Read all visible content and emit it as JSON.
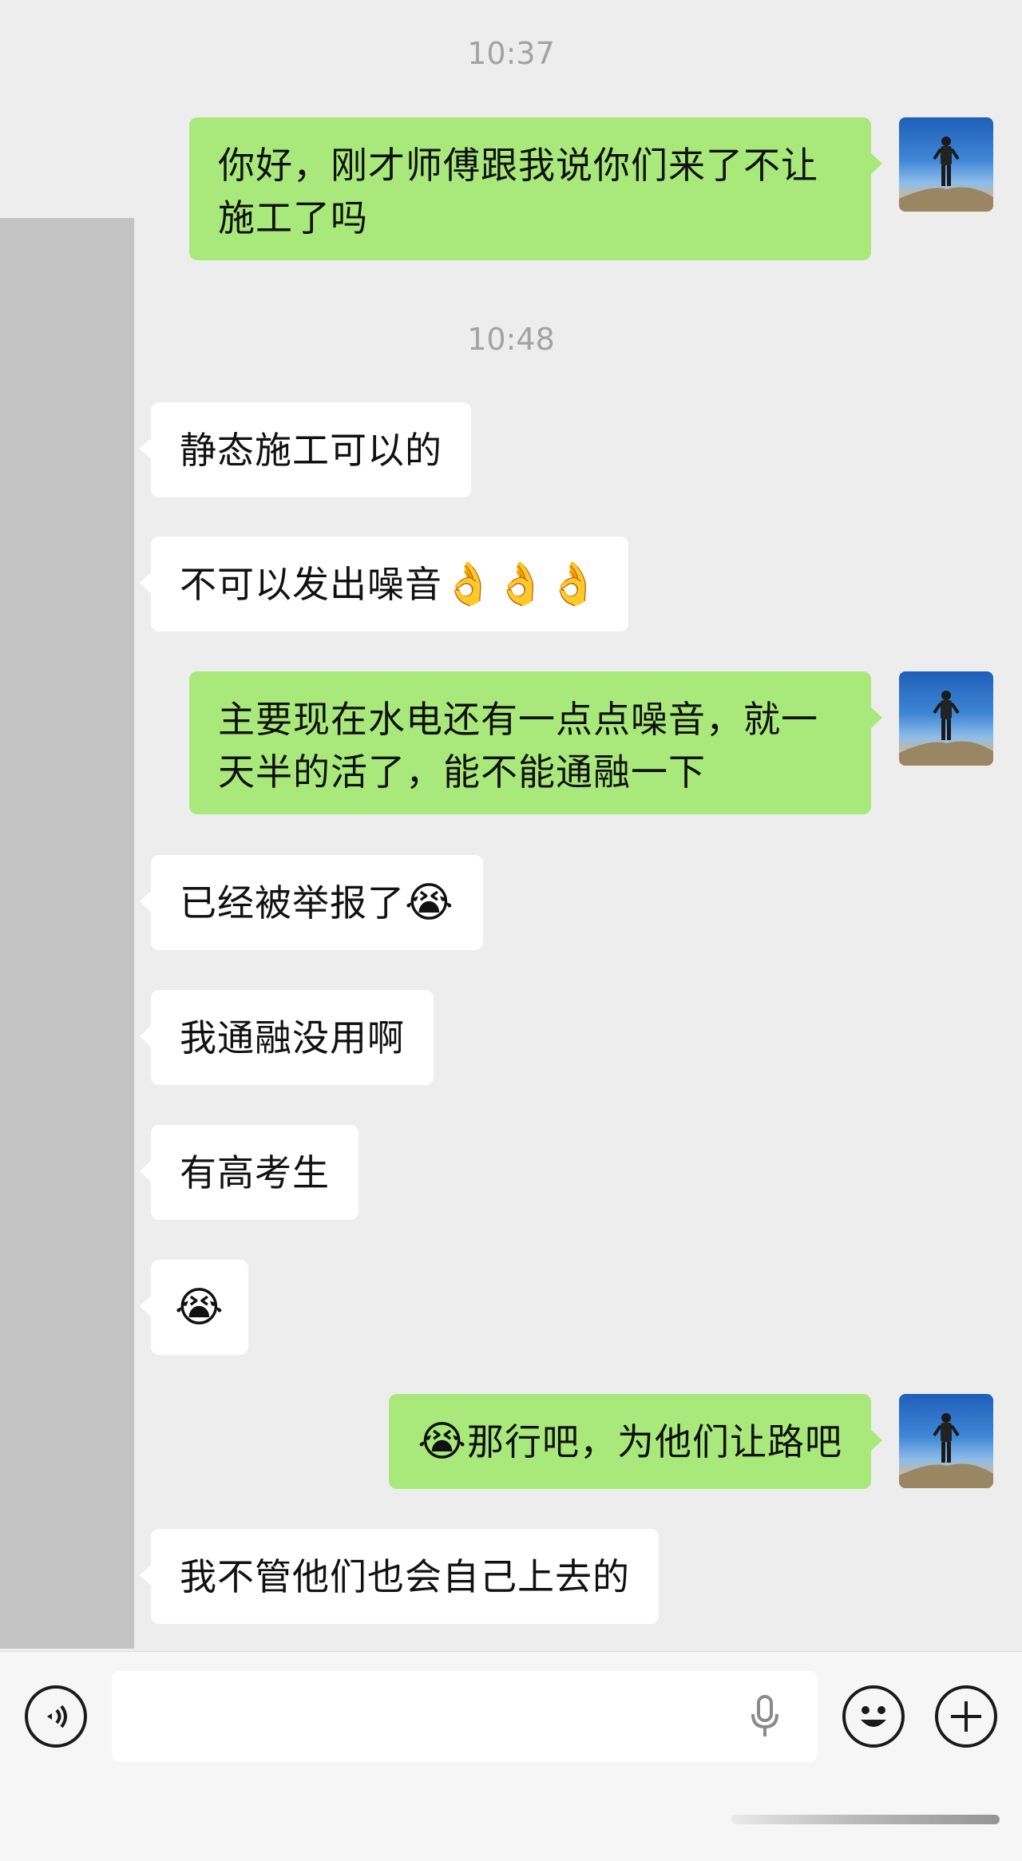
{
  "colors": {
    "background": "#ededed",
    "incoming_bubble": "#ffffff",
    "outgoing_bubble": "#a9e97c",
    "timestamp": "#a3a3a3"
  },
  "timestamps": [
    "10:37",
    "10:48"
  ],
  "messages": [
    {
      "side": "out",
      "text": "你好，刚才师傅跟我说你们来了不让\n施工了吗"
    },
    {
      "side": "in",
      "text": "静态施工可以的"
    },
    {
      "side": "in",
      "text": "不可以发出噪音",
      "emoji": "👌👌👌"
    },
    {
      "side": "out",
      "text": "主要现在水电还有一点点噪音，就一\n天半的活了，能不能通融一下"
    },
    {
      "side": "in",
      "text": "已经被举报了",
      "emoji": "😭"
    },
    {
      "side": "in",
      "text": "我通融没用啊"
    },
    {
      "side": "in",
      "text": "有高考生"
    },
    {
      "side": "in",
      "text": "",
      "emoji": "😭"
    },
    {
      "side": "out",
      "prefix_emoji": "😭",
      "text": "那行吧，为他们让路吧"
    },
    {
      "side": "in",
      "text": "我不管他们也会自己上去的"
    }
  ],
  "input_bar": {
    "voice_icon": "voice-wave-icon",
    "mic_icon": "microphone-icon",
    "emoji_icon": "smiley-icon",
    "plus_icon": "plus-icon",
    "placeholder": ""
  }
}
